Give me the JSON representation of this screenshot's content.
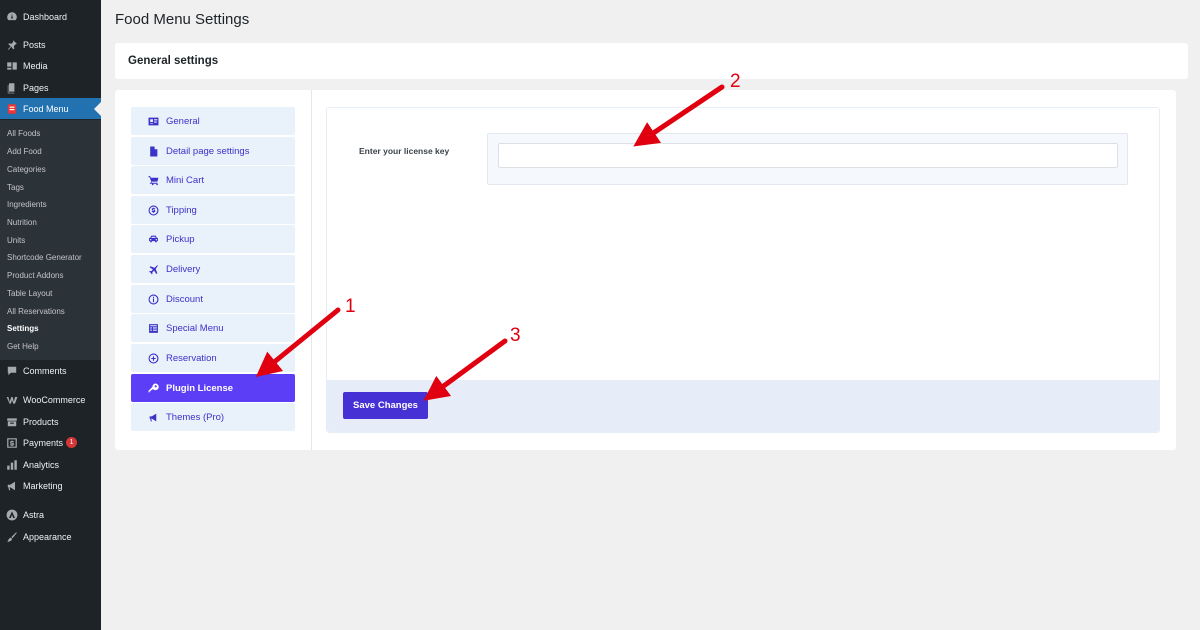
{
  "sidebar": {
    "menu": [
      {
        "label": "Dashboard",
        "icon": "dashboard-icon"
      },
      {
        "label": "Posts",
        "icon": "pin-icon"
      },
      {
        "label": "Media",
        "icon": "media-icon"
      },
      {
        "label": "Pages",
        "icon": "pages-icon"
      },
      {
        "label": "Food Menu",
        "icon": "food-menu-icon"
      },
      {
        "label": "Comments",
        "icon": "comments-icon"
      },
      {
        "label": "WooCommerce",
        "icon": "woocommerce-icon"
      },
      {
        "label": "Products",
        "icon": "products-icon"
      },
      {
        "label": "Payments",
        "icon": "payments-icon",
        "badge": "1"
      },
      {
        "label": "Analytics",
        "icon": "analytics-icon"
      },
      {
        "label": "Marketing",
        "icon": "megaphone-icon"
      },
      {
        "label": "Astra",
        "icon": "astra-icon"
      },
      {
        "label": "Appearance",
        "icon": "brush-icon"
      }
    ],
    "submenu": [
      "All Foods",
      "Add Food",
      "Categories",
      "Tags",
      "Ingredients",
      "Nutrition",
      "Units",
      "Shortcode Generator",
      "Product Addons",
      "Table Layout",
      "All Reservations",
      "Settings",
      "Get Help"
    ],
    "submenu_current": "Settings"
  },
  "page": {
    "title": "Food Menu Settings",
    "section_title": "General settings"
  },
  "settings_nav": [
    {
      "label": "General",
      "icon": "id-card-icon"
    },
    {
      "label": "Detail page settings",
      "icon": "document-icon"
    },
    {
      "label": "Mini Cart",
      "icon": "cart-icon"
    },
    {
      "label": "Tipping",
      "icon": "dollar-circle-icon"
    },
    {
      "label": "Pickup",
      "icon": "car-icon"
    },
    {
      "label": "Delivery",
      "icon": "airplane-icon"
    },
    {
      "label": "Discount",
      "icon": "info-circle-icon"
    },
    {
      "label": "Special Menu",
      "icon": "table-list-icon"
    },
    {
      "label": "Reservation",
      "icon": "plus-circle-icon"
    },
    {
      "label": "Plugin License",
      "icon": "key-icon",
      "active": true
    },
    {
      "label": "Themes (Pro)",
      "icon": "megaphone-icon"
    }
  ],
  "license": {
    "label": "Enter your license key",
    "value": "",
    "placeholder": ""
  },
  "save_button": "Save Changes",
  "annotations": {
    "steps": [
      "1",
      "2",
      "3"
    ],
    "color": "#e0000f"
  },
  "colors": {
    "admin_sidebar": "#1d2327",
    "admin_accent": "#2271b1",
    "nav_active": "#5b3ef6",
    "nav_text": "#3a32c9",
    "button": "#4631d4"
  }
}
